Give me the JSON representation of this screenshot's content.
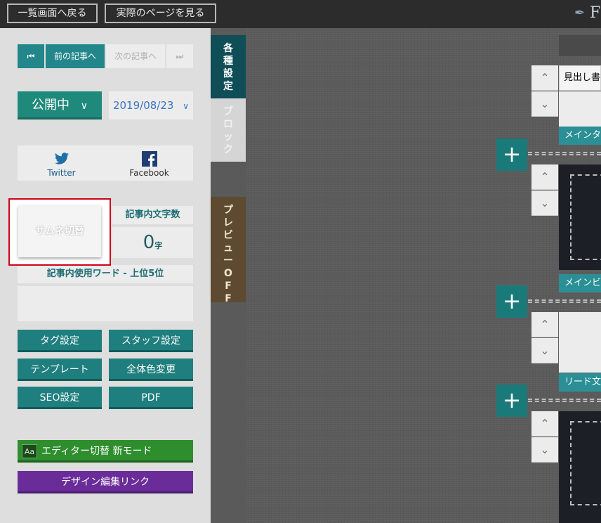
{
  "topbar": {
    "back_to_list": "一覧画面へ戻る",
    "view_page": "実際のページを見る",
    "logo_letter": "F"
  },
  "nav": {
    "first_icon": "skip-first-icon",
    "prev": "前の記事へ",
    "next": "次の記事へ",
    "last_icon": "skip-last-icon"
  },
  "publish": {
    "status": "公開中",
    "date": "2019/08/23"
  },
  "share": {
    "twitter": "Twitter",
    "facebook": "Facebook"
  },
  "thumbnail": {
    "toggle": "サムネ切替"
  },
  "stats": {
    "char_count_label": "記事内文字数",
    "char_count_value": "0",
    "char_unit": "字",
    "words_label": "記事内使用ワード - 上位5位"
  },
  "buttons": {
    "tag": "タグ設定",
    "staff": "スタッフ設定",
    "template": "テンプレート",
    "color": "全体色変更",
    "seo": "SEO設定",
    "pdf": "PDF",
    "editor_icon": "Aa",
    "editor": "エディター切替 新モード",
    "design": "デザイン編集リンク"
  },
  "tabs": {
    "settings": [
      "各",
      "種",
      "設",
      "定"
    ],
    "block": [
      "ブ",
      "ロ",
      "ッ",
      "ク"
    ],
    "preview": [
      "プ",
      "レ",
      "ビ",
      "ュ",
      "ー",
      "O",
      "F",
      "F"
    ]
  },
  "blocks": {
    "heading": "見出し書",
    "main_label_1": "メインタ",
    "main_label_2": "メインビ",
    "lead_label": "リード文"
  },
  "colors": {
    "teal": "#1f7e7e",
    "green": "#2e8e2e",
    "purple": "#6a2c98",
    "highlight": "#d0021b"
  }
}
